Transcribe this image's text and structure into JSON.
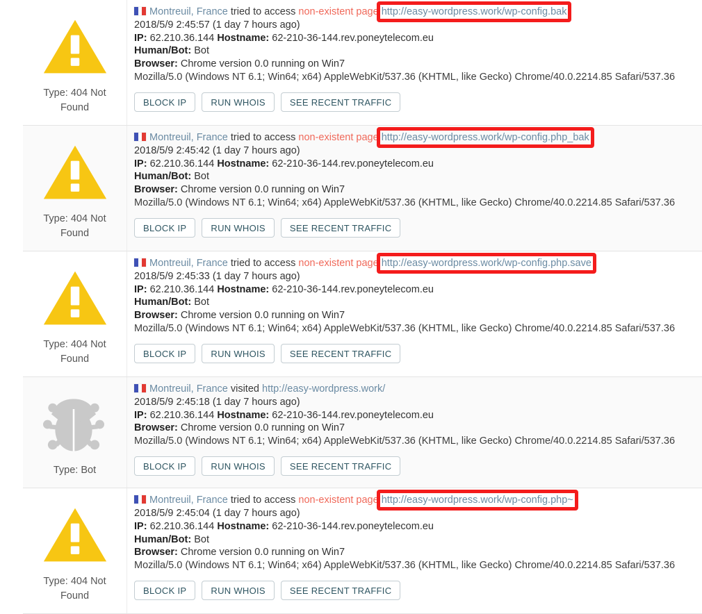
{
  "theme": {
    "accent_red": "#f41c1c",
    "warning_yellow": "#f7c613",
    "bot_gray": "#c9c9c9",
    "link_blue": "#6b8ba3",
    "alert_red": "#f0695a",
    "button_text": "#2e5561",
    "row_alt_bg": "#fafafa"
  },
  "buttons": {
    "block_ip": "BLOCK IP",
    "run_whois": "RUN WHOIS",
    "see_recent_traffic": "SEE RECENT TRAFFIC"
  },
  "labels": {
    "ip": "IP:",
    "hostname": "Hostname:",
    "human_bot": "Human/Bot:",
    "browser": "Browser:"
  },
  "events": [
    {
      "icon": "warning-triangle-icon",
      "type_label": "Type: 404 Not Found",
      "location": "Montreuil, France",
      "action_prefix": "tried to access",
      "action_alert": "non-existent page",
      "url": "http://easy-wordpress.work/wp-config.bak",
      "url_highlighted": true,
      "timestamp": "2018/5/9 2:45:57 (1 day 7 hours ago)",
      "ip": "62.210.36.144",
      "hostname": "62-210-36-144.rev.poneytelecom.eu",
      "human_bot": "Bot",
      "browser": "Chrome version 0.0 running on Win7",
      "user_agent": "Mozilla/5.0 (Windows NT 6.1; Win64; x64) AppleWebKit/537.36 (KHTML, like Gecko) Chrome/40.0.2214.85 Safari/537.36"
    },
    {
      "icon": "warning-triangle-icon",
      "type_label": "Type: 404 Not Found",
      "location": "Montreuil, France",
      "action_prefix": "tried to access",
      "action_alert": "non-existent page",
      "url": "http://easy-wordpress.work/wp-config.php_bak",
      "url_highlighted": true,
      "timestamp": "2018/5/9 2:45:42 (1 day 7 hours ago)",
      "ip": "62.210.36.144",
      "hostname": "62-210-36-144.rev.poneytelecom.eu",
      "human_bot": "Bot",
      "browser": "Chrome version 0.0 running on Win7",
      "user_agent": "Mozilla/5.0 (Windows NT 6.1; Win64; x64) AppleWebKit/537.36 (KHTML, like Gecko) Chrome/40.0.2214.85 Safari/537.36"
    },
    {
      "icon": "warning-triangle-icon",
      "type_label": "Type: 404 Not Found",
      "location": "Montreuil, France",
      "action_prefix": "tried to access",
      "action_alert": "non-existent page",
      "url": "http://easy-wordpress.work/wp-config.php.save",
      "url_highlighted": true,
      "timestamp": "2018/5/9 2:45:33 (1 day 7 hours ago)",
      "ip": "62.210.36.144",
      "hostname": "62-210-36-144.rev.poneytelecom.eu",
      "human_bot": "Bot",
      "browser": "Chrome version 0.0 running on Win7",
      "user_agent": "Mozilla/5.0 (Windows NT 6.1; Win64; x64) AppleWebKit/537.36 (KHTML, like Gecko) Chrome/40.0.2214.85 Safari/537.36"
    },
    {
      "icon": "bug-icon",
      "type_label": "Type: Bot",
      "location": "Montreuil, France",
      "action_prefix": "visited",
      "action_alert": "",
      "url": "http://easy-wordpress.work/",
      "url_highlighted": false,
      "timestamp": "2018/5/9 2:45:18 (1 day 7 hours ago)",
      "ip": "62.210.36.144",
      "hostname": "62-210-36-144.rev.poneytelecom.eu",
      "human_bot": "",
      "browser": "Chrome version 0.0 running on Win7",
      "user_agent": "Mozilla/5.0 (Windows NT 6.1; Win64; x64) AppleWebKit/537.36 (KHTML, like Gecko) Chrome/40.0.2214.85 Safari/537.36"
    },
    {
      "icon": "warning-triangle-icon",
      "type_label": "Type: 404 Not Found",
      "location": "Montreuil, France",
      "action_prefix": "tried to access",
      "action_alert": "non-existent page",
      "url": "http://easy-wordpress.work/wp-config.php~",
      "url_highlighted": true,
      "timestamp": "2018/5/9 2:45:04 (1 day 7 hours ago)",
      "ip": "62.210.36.144",
      "hostname": "62-210-36-144.rev.poneytelecom.eu",
      "human_bot": "Bot",
      "browser": "Chrome version 0.0 running on Win7",
      "user_agent": "Mozilla/5.0 (Windows NT 6.1; Win64; x64) AppleWebKit/537.36 (KHTML, like Gecko) Chrome/40.0.2214.85 Safari/537.36"
    }
  ]
}
